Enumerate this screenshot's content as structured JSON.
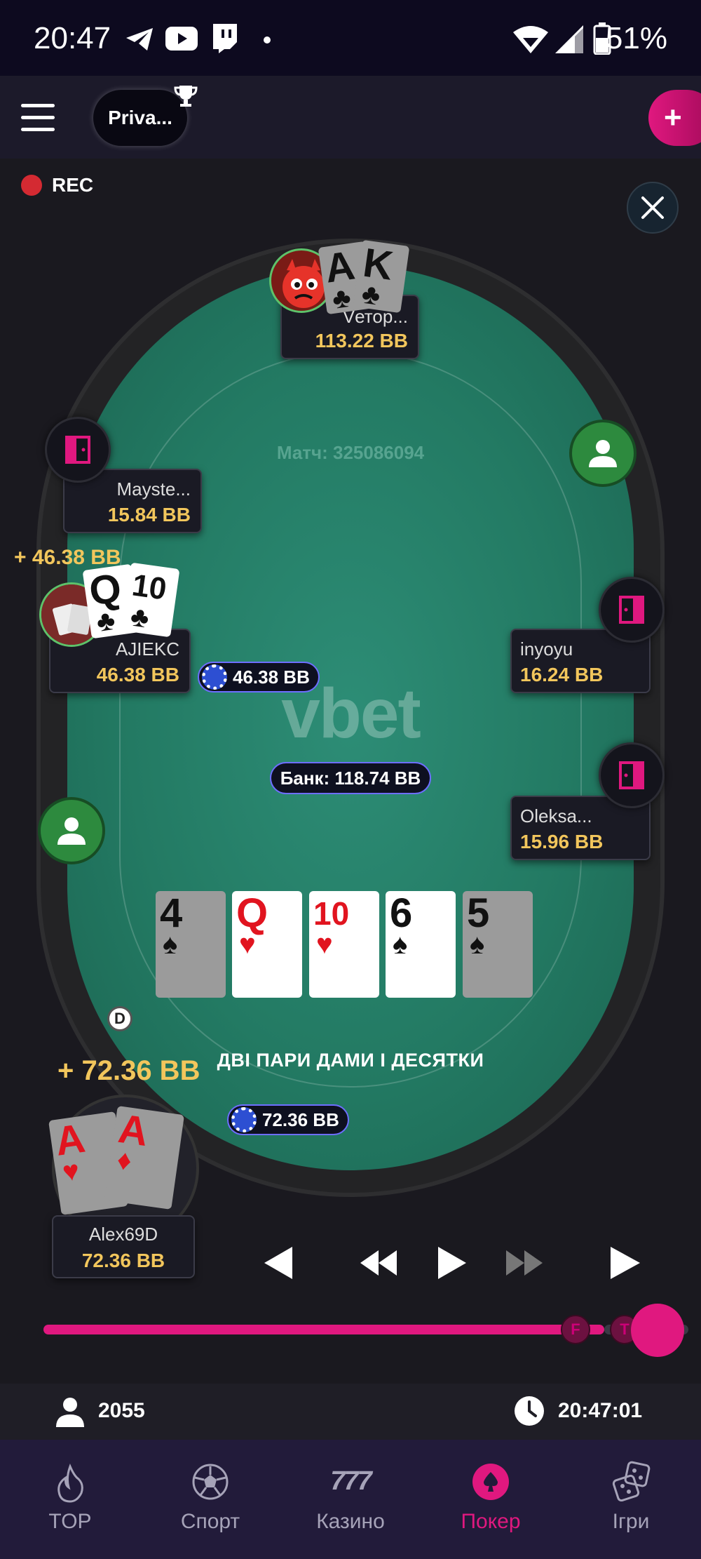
{
  "status_bar": {
    "time": "20:47",
    "battery": "51%",
    "icons": [
      "telegram-icon",
      "youtube-icon",
      "twitch-icon",
      "dot-icon",
      "wifi-icon",
      "signal-icon",
      "battery-icon"
    ]
  },
  "top_bar": {
    "room_label": "Priva...",
    "add_label": "+"
  },
  "replay": {
    "rec_label": "REC",
    "match_label": "Матч: 325086094",
    "brand": "vbet",
    "pot_label": "Банк: 118.74 BB",
    "hand_result": "ДВІ ПАРИ ДАМИ І ДЕСЯТКИ"
  },
  "players": {
    "top": {
      "name": "Vетор...",
      "stack": "113.22 BB",
      "cards": [
        {
          "rank": "A",
          "suit": "♣"
        },
        {
          "rank": "K",
          "suit": "♣"
        }
      ]
    },
    "left_upper": {
      "name": "Mayste...",
      "stack": "15.84 BB"
    },
    "left_mid": {
      "name": "AJIEKC",
      "stack": "46.38 BB",
      "win": "+ 46.38 BB",
      "bet": "46.38 BB",
      "cards": [
        {
          "rank": "Q",
          "suit": "♣"
        },
        {
          "rank": "10",
          "suit": "♣"
        }
      ]
    },
    "right_upper": {
      "name": "inyoyu",
      "stack": "16.24 BB"
    },
    "right_lower": {
      "name": "Oleksa...",
      "stack": "15.96 BB"
    },
    "hero": {
      "name": "Alex69D",
      "stack": "72.36 BB",
      "win": "+ 72.36 BB",
      "bet": "72.36 BB",
      "cards": [
        {
          "rank": "A",
          "suit": "♥"
        },
        {
          "rank": "A",
          "suit": "♦"
        }
      ]
    }
  },
  "board": [
    {
      "rank": "4",
      "suit": "♠",
      "color": "#111111",
      "dim": true
    },
    {
      "rank": "Q",
      "suit": "♥",
      "color": "#e1141f",
      "dim": false
    },
    {
      "rank": "10",
      "suit": "♥",
      "color": "#e1141f",
      "dim": false
    },
    {
      "rank": "6",
      "suit": "♠",
      "color": "#111111",
      "dim": false
    },
    {
      "rank": "5",
      "suit": "♠",
      "color": "#111111",
      "dim": true
    }
  ],
  "dealer_label": "D",
  "slider": {
    "marks": [
      "F",
      "T"
    ],
    "progress": 0.92
  },
  "info_bar": {
    "viewers": "2055",
    "clock": "20:47:01"
  },
  "nav": [
    {
      "label": "TOP",
      "icon": "flame-icon",
      "active": false
    },
    {
      "label": "Спорт",
      "icon": "soccer-ball-icon",
      "active": false
    },
    {
      "label": "Казино",
      "icon": "slot-777-icon",
      "active": false
    },
    {
      "label": "Покер",
      "icon": "poker-chip-icon",
      "active": true
    },
    {
      "label": "Ігри",
      "icon": "dice-icon",
      "active": false
    }
  ],
  "colors": {
    "accent": "#e0187f",
    "felt": "#237a63",
    "stack": "#f2c65c",
    "bet_border": "#6d6eff"
  }
}
